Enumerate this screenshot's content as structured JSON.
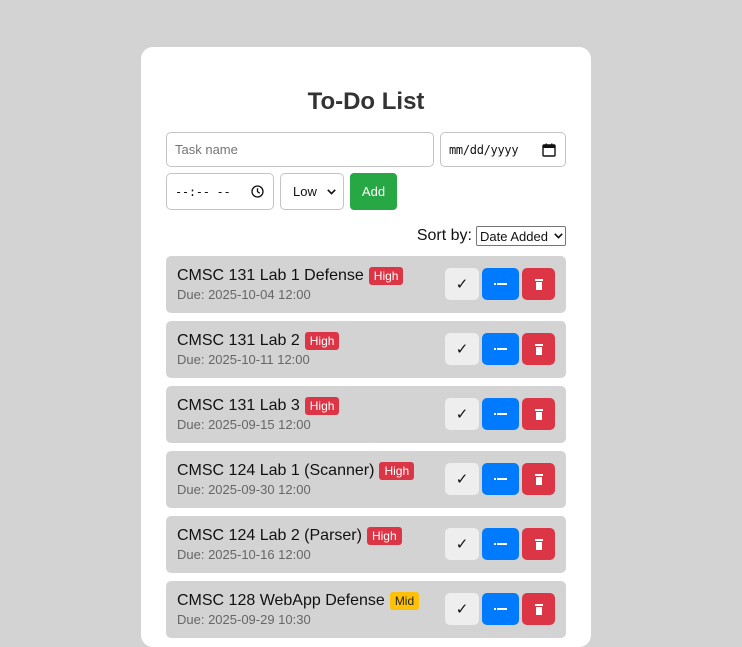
{
  "app": {
    "title": "To-Do List"
  },
  "form": {
    "task_placeholder": "Task name",
    "date_placeholder": "mm/dd/yyyy",
    "time_placeholder": "--:-- --",
    "priority_selected": "Low",
    "add_label": "Add"
  },
  "sort": {
    "label": "Sort by:",
    "selected": "Date Added"
  },
  "actions": {
    "done_glyph": "✓"
  },
  "colors": {
    "high": "#dc3545",
    "mid": "#ffc107",
    "add": "#28a745",
    "edit": "#007bff"
  },
  "tasks": [
    {
      "name": "CMSC 131 Lab 1 Defense",
      "priority": "High",
      "due": "Due: 2025-10-04 12:00"
    },
    {
      "name": "CMSC 131 Lab 2",
      "priority": "High",
      "due": "Due: 2025-10-11 12:00"
    },
    {
      "name": "CMSC 131 Lab 3",
      "priority": "High",
      "due": "Due: 2025-09-15 12:00"
    },
    {
      "name": "CMSC 124 Lab 1 (Scanner)",
      "priority": "High",
      "due": "Due: 2025-09-30 12:00"
    },
    {
      "name": "CMSC 124 Lab 2 (Parser)",
      "priority": "High",
      "due": "Due: 2025-10-16 12:00"
    },
    {
      "name": "CMSC 128 WebApp Defense",
      "priority": "Mid",
      "due": "Due: 2025-09-29 10:30"
    }
  ]
}
